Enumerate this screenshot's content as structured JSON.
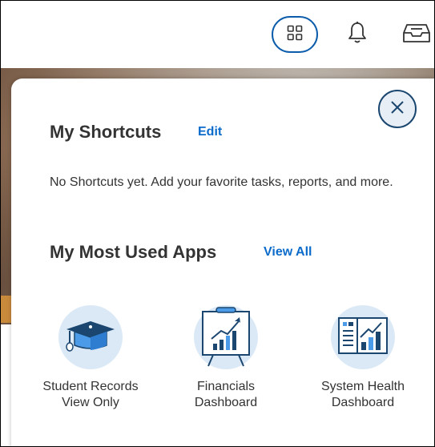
{
  "header": {
    "apps_icon": "apps-grid-icon",
    "notifications_icon": "bell-icon",
    "inbox_icon": "inbox-icon"
  },
  "panel": {
    "close_icon": "close-icon",
    "shortcuts": {
      "title": "My Shortcuts",
      "edit_label": "Edit",
      "empty_message": "No Shortcuts yet. Add your favorite tasks, reports, and more."
    },
    "most_used": {
      "title": "My Most Used Apps",
      "view_all_label": "View All",
      "apps": [
        {
          "line1": "Student Records",
          "line2": "View Only",
          "icon": "graduation-cap-icon"
        },
        {
          "line1": "Financials",
          "line2": "Dashboard",
          "icon": "chart-easel-icon"
        },
        {
          "line1": "System Health",
          "line2": "Dashboard",
          "icon": "dashboard-charts-icon"
        }
      ]
    }
  },
  "colors": {
    "accent": "#0b6bcb",
    "apps_ring": "#0b5cab",
    "icon_circle": "#dbe9f7",
    "icon_blue": "#4c9be8",
    "icon_navy": "#1a466f"
  }
}
